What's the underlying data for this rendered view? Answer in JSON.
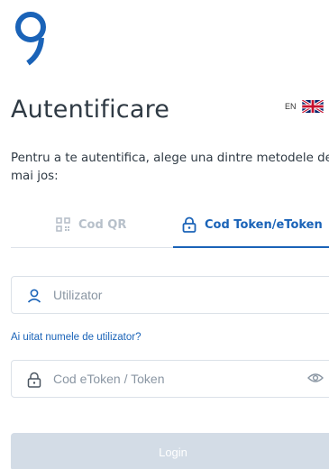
{
  "header": {
    "title": "Autentificare",
    "language_code": "EN"
  },
  "description": "Pentru a te autentifica, alege una dintre metodele de mai jos:",
  "tabs": [
    {
      "label": "Cod QR",
      "active": false,
      "icon": "qr-code-icon"
    },
    {
      "label": "Cod Token/eToken",
      "active": true,
      "icon": "lock-icon"
    }
  ],
  "form": {
    "username_placeholder": "Utilizator",
    "username_value": "",
    "forgot_username_link": "Ai uitat numele de utilizator?",
    "token_placeholder": "Cod eToken / Token",
    "token_value": "",
    "login_label": "Login"
  },
  "colors": {
    "accent": "#1a63b8",
    "text": "#2f3a44",
    "inactive_tab": "#b7c0ca",
    "login_disabled_bg": "#d3dce6"
  }
}
